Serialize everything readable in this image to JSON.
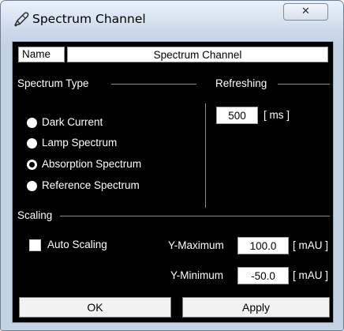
{
  "window": {
    "title": "Spectrum Channel",
    "title_icon": "pen-icon",
    "close_glyph": "✕"
  },
  "name": {
    "label": "Name",
    "value": "Spectrum Channel"
  },
  "spectrum_type": {
    "label": "Spectrum Type",
    "options": [
      {
        "label": "Dark Current",
        "selected": false
      },
      {
        "label": "Lamp Spectrum",
        "selected": false
      },
      {
        "label": "Absorption Spectrum",
        "selected": true
      },
      {
        "label": "Reference Spectrum",
        "selected": false
      }
    ]
  },
  "refreshing": {
    "label": "Refreshing",
    "value": "500",
    "unit": "[ ms ]"
  },
  "scaling": {
    "label": "Scaling",
    "auto_label": "Auto Scaling",
    "auto_checked": false,
    "ymax_label": "Y-Maximum",
    "ymax_value": "100.0",
    "ymax_unit": "[ mAU ]",
    "ymin_label": "Y-Minimum",
    "ymin_value": "-50.0",
    "ymin_unit": "[ mAU ]"
  },
  "buttons": {
    "ok": "OK",
    "apply": "Apply"
  }
}
